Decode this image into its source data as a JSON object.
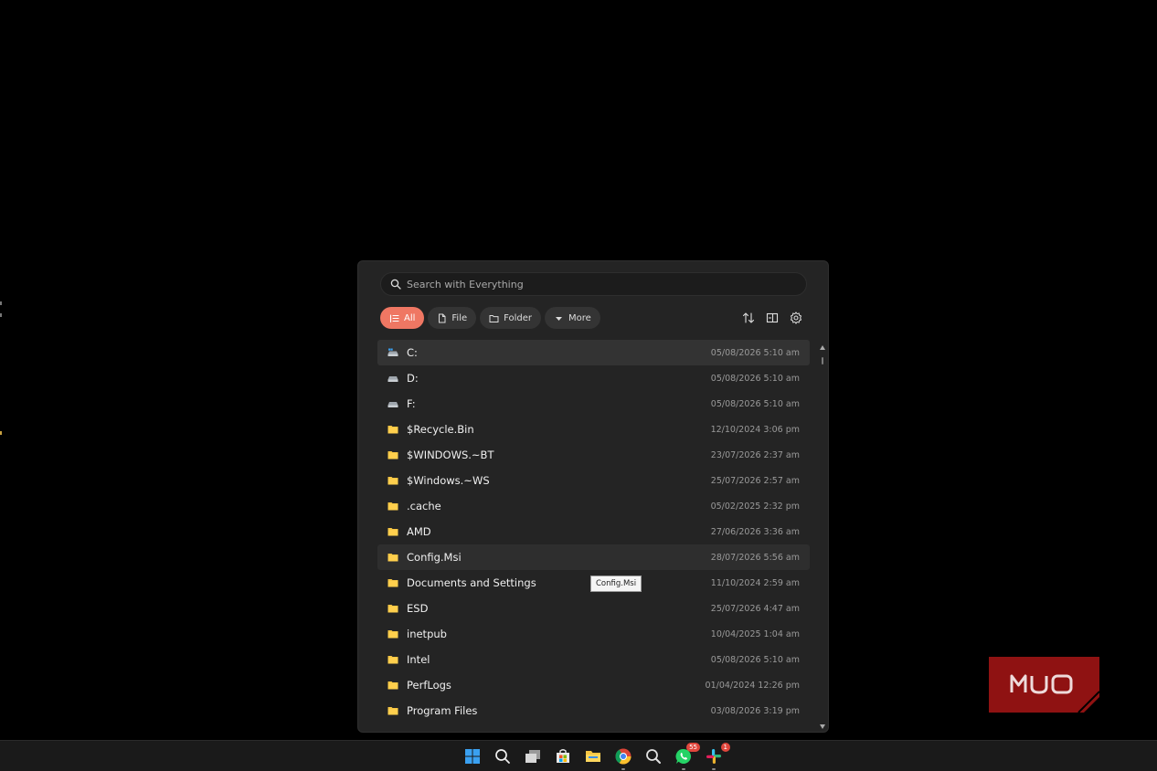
{
  "search": {
    "placeholder": "Search with Everything"
  },
  "filters": [
    {
      "label": "All",
      "active": true
    },
    {
      "label": "File",
      "active": false
    },
    {
      "label": "Folder",
      "active": false
    },
    {
      "label": "More",
      "active": false
    }
  ],
  "tools": [
    "sort-icon",
    "preview-pane-icon",
    "gear-icon"
  ],
  "items": [
    {
      "name": "C:",
      "date": "05/08/2026 5:10 am",
      "icon": "system-drive-icon"
    },
    {
      "name": "D:",
      "date": "05/08/2026 5:10 am",
      "icon": "drive-icon"
    },
    {
      "name": "F:",
      "date": "05/08/2026 5:10 am",
      "icon": "drive-icon"
    },
    {
      "name": "$Recycle.Bin",
      "date": "12/10/2024 3:06 pm",
      "icon": "folder-icon"
    },
    {
      "name": "$WINDOWS.~BT",
      "date": "23/07/2026 2:37 am",
      "icon": "folder-icon"
    },
    {
      "name": "$Windows.~WS",
      "date": "25/07/2026 2:57 am",
      "icon": "folder-icon"
    },
    {
      "name": ".cache",
      "date": "05/02/2025 2:32 pm",
      "icon": "folder-icon"
    },
    {
      "name": "AMD",
      "date": "27/06/2026 3:36 am",
      "icon": "folder-icon"
    },
    {
      "name": "Config.Msi",
      "date": "28/07/2026 5:56 am",
      "icon": "folder-icon"
    },
    {
      "name": "Documents and Settings",
      "date": "11/10/2024 2:59 am",
      "icon": "folder-icon"
    },
    {
      "name": "ESD",
      "date": "25/07/2026 4:47 am",
      "icon": "folder-icon"
    },
    {
      "name": "inetpub",
      "date": "10/04/2025 1:04 am",
      "icon": "folder-icon"
    },
    {
      "name": "Intel",
      "date": "05/08/2026 5:10 am",
      "icon": "folder-icon"
    },
    {
      "name": "PerfLogs",
      "date": "01/04/2024 12:26 pm",
      "icon": "folder-icon"
    },
    {
      "name": "Program Files",
      "date": "03/08/2026 3:19 pm",
      "icon": "folder-icon"
    }
  ],
  "tooltip": {
    "text": "Config.Msi"
  },
  "watermark": {
    "text": "MUO"
  },
  "taskbar": {
    "icons": [
      "windows-start-icon",
      "search-icon",
      "task-view-icon",
      "store-icon",
      "file-explorer-icon",
      "chrome-icon",
      "everything-search-icon",
      "whatsapp-icon",
      "slack-icon"
    ],
    "whatsapp_badge": "55",
    "slack_badge": "1"
  },
  "colors": {
    "accent": "#ef7763",
    "folder": "#f5c543",
    "watermark": "#8f1212"
  }
}
